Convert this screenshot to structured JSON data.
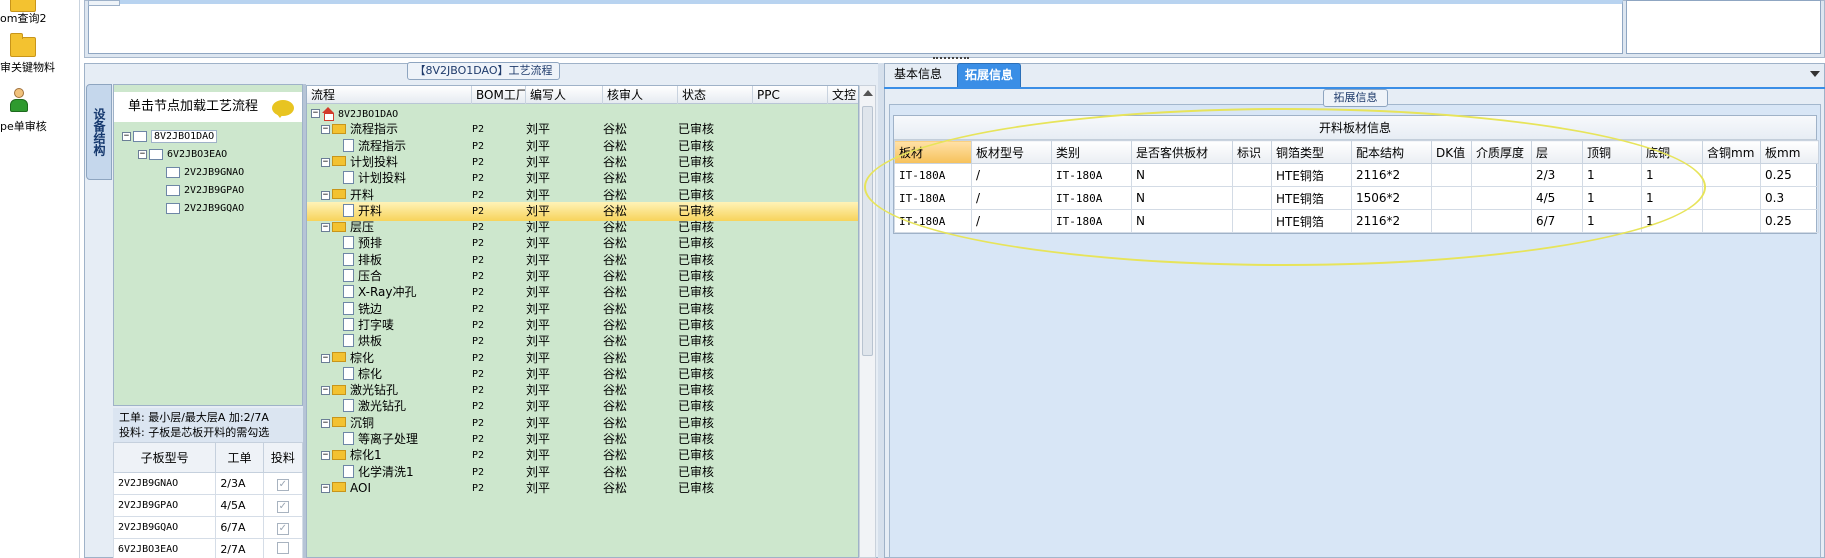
{
  "launcher": {
    "items": [
      {
        "label": "om查询2"
      },
      {
        "label": "审关键物料"
      },
      {
        "label": "pe单审核"
      }
    ]
  },
  "left": {
    "title": "【8V2JBO1DAO】工艺流程",
    "vtab": "设备结构",
    "tree_head": "单击节点加载工艺流程",
    "tree": [
      {
        "label": "8V2JBO1DAO"
      },
      {
        "label": "6V2JBO3EAO"
      },
      {
        "label": "2V2JB9GNAO"
      },
      {
        "label": "2V2JB9GPAO"
      },
      {
        "label": "2V2JB9GQAO"
      }
    ],
    "info_line1": "工单: 最小层/最大层A 加:2/7A",
    "info_line2": "投料: 子板是芯板开料的需勾选",
    "sub_table": {
      "headers": [
        "子板型号",
        "工单",
        "投料"
      ],
      "rows": [
        {
          "model": "2V2JB9GNAO",
          "order": "2/3A",
          "checked": true
        },
        {
          "model": "2V2JB9GPAO",
          "order": "4/5A",
          "checked": true
        },
        {
          "model": "2V2JB9GQAO",
          "order": "6/7A",
          "checked": true
        },
        {
          "model": "6V2JBO3EAO",
          "order": "2/7A",
          "checked": false
        }
      ]
    }
  },
  "process": {
    "headers": [
      "流程",
      "BOM工厂",
      "编写人",
      "核审人",
      "状态",
      "PPC",
      "文控"
    ],
    "rows": [
      {
        "kind": "root",
        "name": "8V2JBO1DAO",
        "bom": "",
        "writer": "",
        "reviewer": "",
        "status": ""
      },
      {
        "kind": "folder",
        "name": "流程指示",
        "bom": "P2",
        "writer": "刘平",
        "reviewer": "谷松",
        "status": "已审核"
      },
      {
        "kind": "doc",
        "name": "流程指示",
        "bom": "P2",
        "writer": "刘平",
        "reviewer": "谷松",
        "status": "已审核"
      },
      {
        "kind": "folder",
        "name": "计划投料",
        "bom": "P2",
        "writer": "刘平",
        "reviewer": "谷松",
        "status": "已审核"
      },
      {
        "kind": "doc",
        "name": "计划投料",
        "bom": "P2",
        "writer": "刘平",
        "reviewer": "谷松",
        "status": "已审核"
      },
      {
        "kind": "folder",
        "name": "开料",
        "bom": "P2",
        "writer": "刘平",
        "reviewer": "谷松",
        "status": "已审核"
      },
      {
        "kind": "doc",
        "name": "开料",
        "bom": "P2",
        "writer": "刘平",
        "reviewer": "谷松",
        "status": "已审核",
        "selected": true
      },
      {
        "kind": "folder",
        "name": "层压",
        "bom": "P2",
        "writer": "刘平",
        "reviewer": "谷松",
        "status": "已审核"
      },
      {
        "kind": "doc",
        "name": "预排",
        "bom": "P2",
        "writer": "刘平",
        "reviewer": "谷松",
        "status": "已审核"
      },
      {
        "kind": "doc",
        "name": "排板",
        "bom": "P2",
        "writer": "刘平",
        "reviewer": "谷松",
        "status": "已审核"
      },
      {
        "kind": "doc",
        "name": "压合",
        "bom": "P2",
        "writer": "刘平",
        "reviewer": "谷松",
        "status": "已审核"
      },
      {
        "kind": "doc",
        "name": "X-Ray冲孔",
        "bom": "P2",
        "writer": "刘平",
        "reviewer": "谷松",
        "status": "已审核"
      },
      {
        "kind": "doc",
        "name": "铣边",
        "bom": "P2",
        "writer": "刘平",
        "reviewer": "谷松",
        "status": "已审核"
      },
      {
        "kind": "doc",
        "name": "打字唛",
        "bom": "P2",
        "writer": "刘平",
        "reviewer": "谷松",
        "status": "已审核"
      },
      {
        "kind": "doc",
        "name": "烘板",
        "bom": "P2",
        "writer": "刘平",
        "reviewer": "谷松",
        "status": "已审核"
      },
      {
        "kind": "folder",
        "name": "棕化",
        "bom": "P2",
        "writer": "刘平",
        "reviewer": "谷松",
        "status": "已审核"
      },
      {
        "kind": "doc",
        "name": "棕化",
        "bom": "P2",
        "writer": "刘平",
        "reviewer": "谷松",
        "status": "已审核"
      },
      {
        "kind": "folder",
        "name": "激光钻孔",
        "bom": "P2",
        "writer": "刘平",
        "reviewer": "谷松",
        "status": "已审核"
      },
      {
        "kind": "doc",
        "name": "激光钻孔",
        "bom": "P2",
        "writer": "刘平",
        "reviewer": "谷松",
        "status": "已审核"
      },
      {
        "kind": "folder",
        "name": "沉铜",
        "bom": "P2",
        "writer": "刘平",
        "reviewer": "谷松",
        "status": "已审核"
      },
      {
        "kind": "doc",
        "name": "等离子处理",
        "bom": "P2",
        "writer": "刘平",
        "reviewer": "谷松",
        "status": "已审核"
      },
      {
        "kind": "folder",
        "name": "棕化1",
        "bom": "P2",
        "writer": "刘平",
        "reviewer": "谷松",
        "status": "已审核"
      },
      {
        "kind": "doc",
        "name": "化学清洗1",
        "bom": "P2",
        "writer": "刘平",
        "reviewer": "谷松",
        "status": "已审核"
      },
      {
        "kind": "folder",
        "name": "AOI",
        "bom": "P2",
        "writer": "刘平",
        "reviewer": "谷松",
        "status": "已审核"
      }
    ]
  },
  "right": {
    "tabs": [
      "基本信息",
      "拓展信息"
    ],
    "group_label": "拓展信息",
    "table_title": "开料板材信息",
    "headers": [
      "板材",
      "板材型号",
      "类别",
      "是否客供板材",
      "标识",
      "铜箔类型",
      "配本结构",
      "DK值",
      "介质厚度",
      "层",
      "顶铜",
      "底铜",
      "含铜mm",
      "板mm"
    ],
    "rows": [
      [
        "IT-180A",
        "/",
        "IT-180A",
        "N",
        "",
        "HTE铜箔",
        "2116*2",
        "",
        "",
        "2/3",
        "1",
        "1",
        "",
        "0.25"
      ],
      [
        "IT-180A",
        "/",
        "IT-180A",
        "N",
        "",
        "HTE铜箔",
        "1506*2",
        "",
        "",
        "4/5",
        "1",
        "1",
        "",
        "0.3"
      ],
      [
        "IT-180A",
        "/",
        "IT-180A",
        "N",
        "",
        "HTE铜箔",
        "2116*2",
        "",
        "",
        "6/7",
        "1",
        "1",
        "",
        "0.25"
      ]
    ]
  },
  "colors": {
    "accent": "#3a8ee6",
    "tree_bg": "#cde7cd",
    "highlight": "#f7d35b",
    "annotation": "#e7e45a"
  }
}
